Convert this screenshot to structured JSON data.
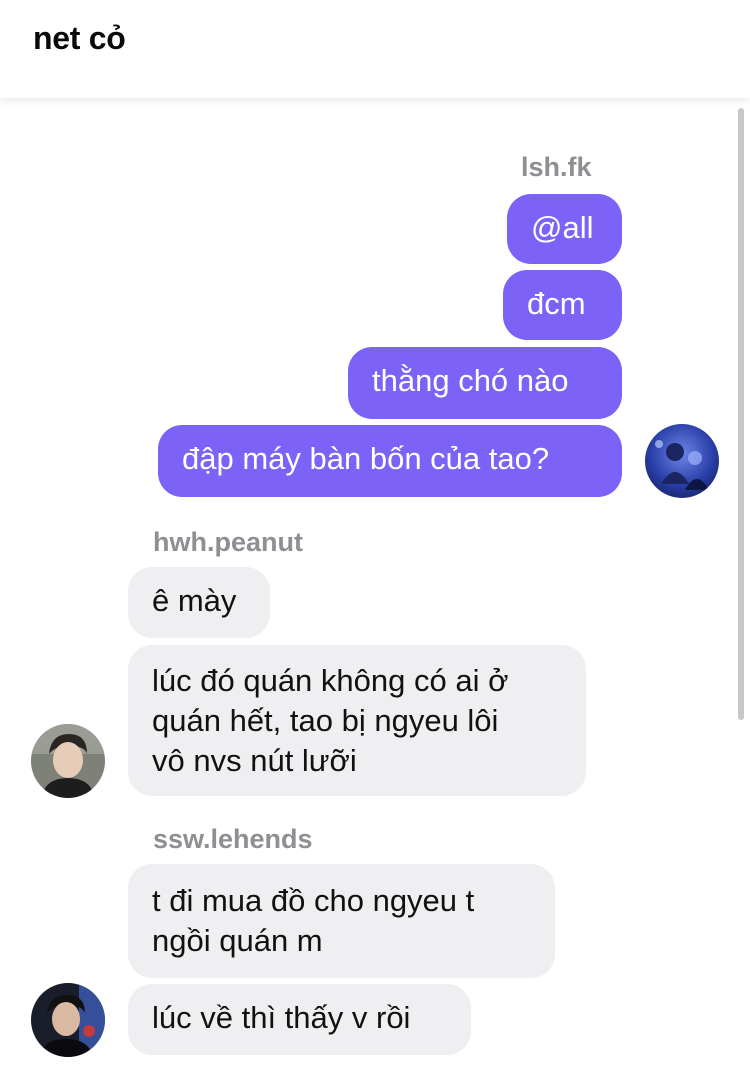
{
  "header": {
    "title": "net cỏ"
  },
  "groups": [
    {
      "sender": "lsh.fk",
      "direction": "outgoing",
      "avatar_icon": "user-avatar-blue-photo",
      "messages": [
        "@all",
        "đcm",
        "thằng chó nào",
        "đập máy bàn bốn của tao?"
      ]
    },
    {
      "sender": "hwh.peanut",
      "direction": "incoming",
      "avatar_icon": "user-avatar-photo",
      "messages": [
        "ê mày",
        "lúc đó quán không có ai ở\nquán hết, tao bị ngyeu lôi\nvô nvs nút lưỡi"
      ]
    },
    {
      "sender": "ssw.lehends",
      "direction": "incoming",
      "avatar_icon": "user-avatar-dark-photo",
      "messages": [
        "t đi mua đồ cho ngyeu t\nngồi quán m",
        "lúc về thì thấy v rồi"
      ]
    }
  ],
  "colors": {
    "outgoing_bubble": "#7c62f6",
    "incoming_bubble": "#efeff2",
    "sender_label": "#8e8e93"
  }
}
